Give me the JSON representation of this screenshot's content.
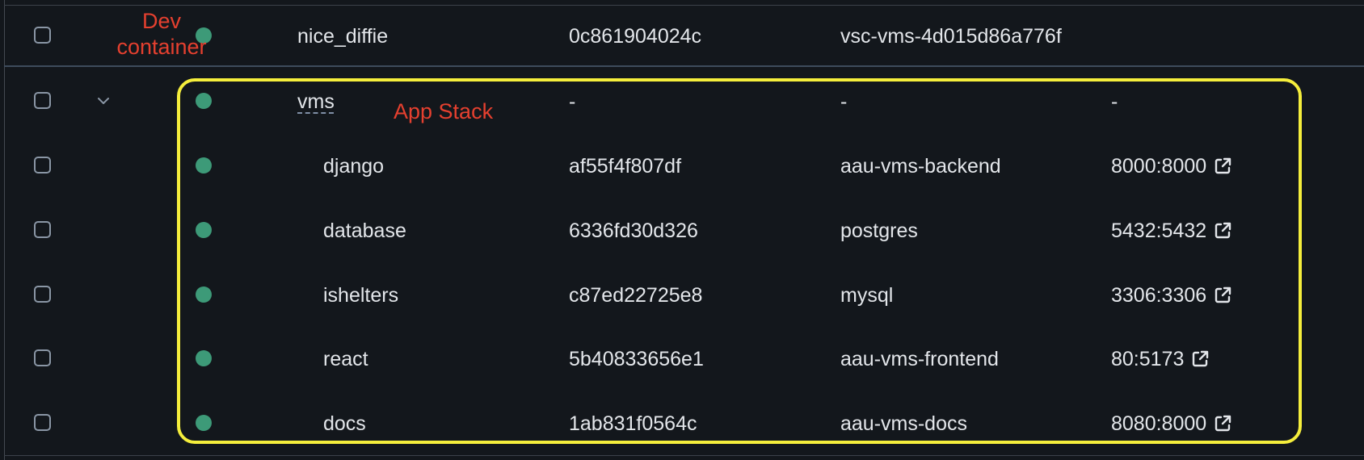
{
  "annotations": {
    "dev_container_line1": "Dev",
    "dev_container_line2": "container",
    "app_stack": "App Stack",
    "app_stack_box_color": "#f5ee3c",
    "annotation_text_color": "#e5402f"
  },
  "colors": {
    "background": "#13171c",
    "status_running": "#3d9a78",
    "text": "#e3e6ea"
  },
  "rows": [
    {
      "name": "nice_diffie",
      "container_id": "0c861904024c",
      "image": "vsc-vms-4d015d86a776f",
      "port": "",
      "status": "running"
    },
    {
      "name": "vms",
      "container_id": "-",
      "image": "-",
      "port": "-",
      "status": "running",
      "expandable": true,
      "expand_icon": "chevron-down-icon"
    },
    {
      "name": "django",
      "container_id": "af55f4f807df",
      "image": "aau-vms-backend",
      "port": "8000:8000",
      "status": "running"
    },
    {
      "name": "database",
      "container_id": "6336fd30d326",
      "image": "postgres",
      "port": "5432:5432",
      "status": "running"
    },
    {
      "name": "ishelters",
      "container_id": "c87ed22725e8",
      "image": "mysql",
      "port": "3306:3306",
      "status": "running"
    },
    {
      "name": "react",
      "container_id": "5b40833656e1",
      "image": "aau-vms-frontend",
      "port": "80:5173",
      "status": "running"
    },
    {
      "name": "docs",
      "container_id": "1ab831f0564c",
      "image": "aau-vms-docs",
      "port": "8080:8000",
      "status": "running"
    }
  ]
}
